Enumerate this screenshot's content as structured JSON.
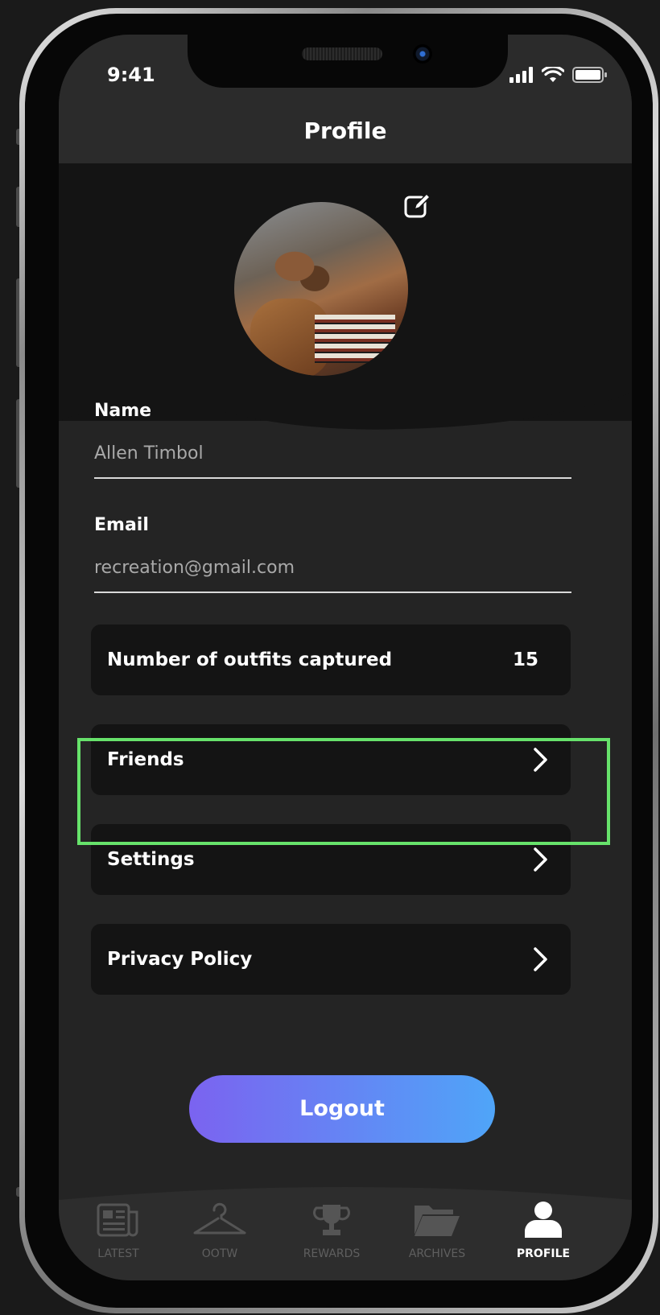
{
  "status_bar": {
    "time": "9:41"
  },
  "header": {
    "title": "Profile"
  },
  "profile": {
    "name_label": "Name",
    "name_value": "Allen Timbol",
    "email_label": "Email",
    "email_value": "recreation@gmail.com"
  },
  "stats": {
    "outfits_label": "Number of outfits captured",
    "outfits_count": "15"
  },
  "menu": [
    {
      "label": "Friends",
      "icon": "chevron-right-icon"
    },
    {
      "label": "Settings",
      "icon": "chevron-right-icon"
    },
    {
      "label": "Privacy Policy",
      "icon": "chevron-right-icon"
    }
  ],
  "logout_label": "Logout",
  "tabs": [
    {
      "label": "LATEST",
      "icon": "newspaper-icon",
      "active": false
    },
    {
      "label": "OOTW",
      "icon": "hanger-icon",
      "active": false
    },
    {
      "label": "REWARDS",
      "icon": "trophy-icon",
      "active": false
    },
    {
      "label": "ARCHIVES",
      "icon": "folder-icon",
      "active": false
    },
    {
      "label": "PROFILE",
      "icon": "user-icon",
      "active": true
    }
  ],
  "colors": {
    "highlight": "#67e26b",
    "logout_start": "#7b63f0",
    "logout_end": "#4fa5f8",
    "background": "#242424",
    "row_bg": "#141414"
  }
}
